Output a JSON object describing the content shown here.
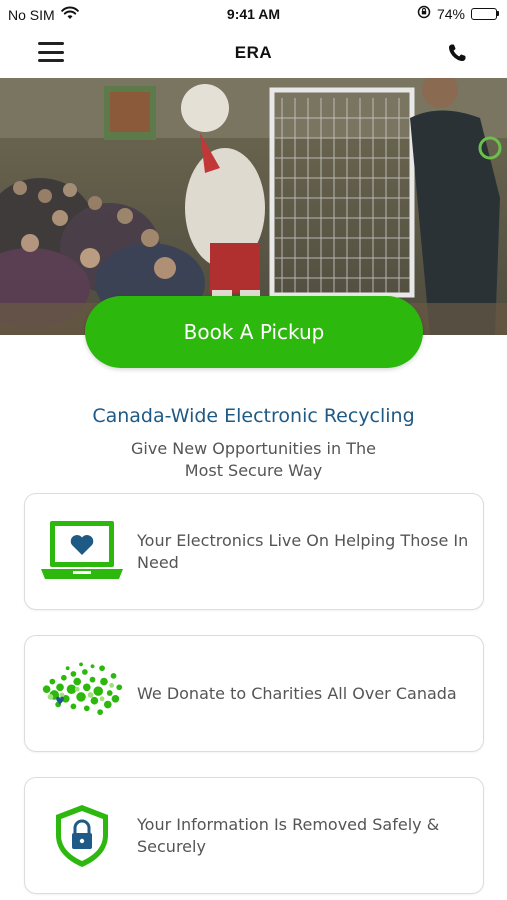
{
  "status_bar": {
    "carrier": "No SIM",
    "time": "9:41 AM",
    "battery_percent": "74%",
    "battery_level": 0.74,
    "icons": [
      "wifi-icon",
      "orientation-lock-icon",
      "battery-icon"
    ]
  },
  "nav": {
    "title": "ERA",
    "left_icon": "menu-icon",
    "right_icon": "phone-icon"
  },
  "hero": {
    "cta_label": "Book A Pickup"
  },
  "intro": {
    "headline": "Canada-Wide Electronic Recycling",
    "subline_1": "Give New Opportunities in The",
    "subline_2": "Most Secure Way"
  },
  "cards": [
    {
      "icon": "laptop-heart-icon",
      "text": "Your Electronics Live On Helping Those In Need"
    },
    {
      "icon": "canada-map-icon",
      "text": "We Donate to Charities All Over Canada"
    },
    {
      "icon": "shield-lock-icon",
      "text": "Your Information Is Removed Safely & Securely"
    }
  ],
  "colors": {
    "accent_green": "#2db80e",
    "headline_blue": "#1e5a85",
    "text_gray": "#555555"
  }
}
